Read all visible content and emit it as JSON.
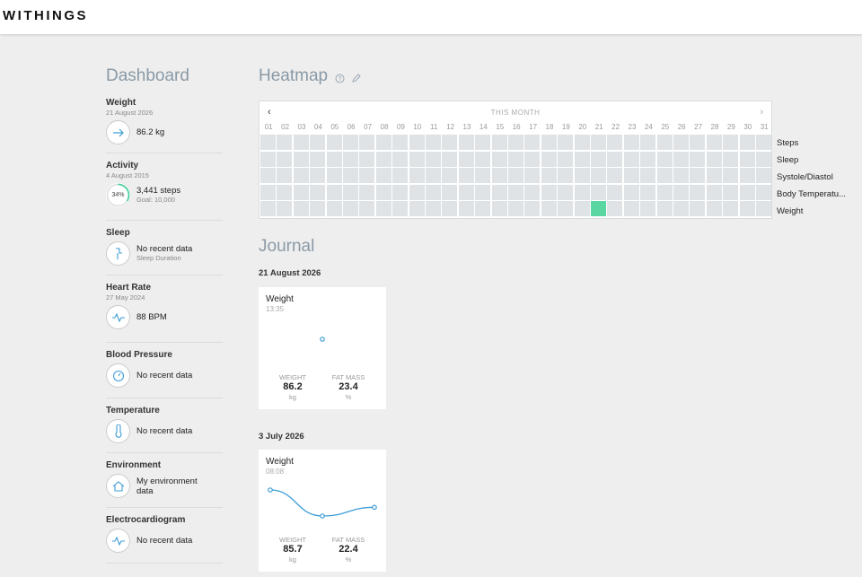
{
  "brand": "WITHINGS",
  "sidebar": {
    "title": "Dashboard",
    "items": [
      {
        "label": "Weight",
        "date": "21 August 2026",
        "value": "86.2 kg",
        "sub": "",
        "icon": "arrow-right-icon"
      },
      {
        "label": "Activity",
        "date": "4 August 2015",
        "value": "3,441 steps",
        "sub": "Goal: 10,000",
        "icon": "activity-ring-icon",
        "ring_text": "34%",
        "progress": 0.34
      },
      {
        "label": "Sleep",
        "date": "",
        "value": "No recent data",
        "sub": "Sleep Duration",
        "icon": "sleep-icon"
      },
      {
        "label": "Heart Rate",
        "date": "27 May 2024",
        "value": "88 BPM",
        "sub": "",
        "icon": "heartbeat-icon"
      },
      {
        "label": "Blood Pressure",
        "date": "",
        "value": "No recent data",
        "sub": "",
        "icon": "gauge-icon"
      },
      {
        "label": "Temperature",
        "date": "",
        "value": "No recent data",
        "sub": "",
        "icon": "thermometer-icon"
      },
      {
        "label": "Environment",
        "date": "",
        "value": "My environment data",
        "sub": "",
        "icon": "home-icon"
      },
      {
        "label": "Electrocardiogram",
        "date": "",
        "value": "No recent data",
        "sub": "",
        "icon": "ecg-icon"
      }
    ]
  },
  "heatmap": {
    "title": "Heatmap",
    "month_label": "THIS MONTH",
    "days": [
      "01",
      "02",
      "03",
      "04",
      "05",
      "06",
      "07",
      "08",
      "09",
      "10",
      "11",
      "12",
      "13",
      "14",
      "15",
      "16",
      "17",
      "18",
      "19",
      "20",
      "21",
      "22",
      "23",
      "24",
      "25",
      "26",
      "27",
      "28",
      "29",
      "30",
      "31"
    ],
    "rows": [
      "Steps",
      "Sleep",
      "Systole/Diastol",
      "Body Temperatu...",
      "Weight"
    ],
    "active_cells": [
      {
        "row": 4,
        "day": 21
      }
    ],
    "active_color": "#5ad6a3"
  },
  "journal": {
    "title": "Journal",
    "entries": [
      {
        "date": "21 August 2026",
        "card_title": "Weight",
        "time": "13:35",
        "points": [
          86.2
        ],
        "stats": [
          {
            "label": "WEIGHT",
            "value": "86.2",
            "unit": "kg"
          },
          {
            "label": "FAT MASS",
            "value": "23.4",
            "unit": "%"
          }
        ]
      },
      {
        "date": "3 July 2026",
        "card_title": "Weight",
        "time": "08:08",
        "points": [
          86.7,
          85.5,
          85.9
        ],
        "stats": [
          {
            "label": "WEIGHT",
            "value": "85.7",
            "unit": "kg"
          },
          {
            "label": "FAT MASS",
            "value": "22.4",
            "unit": "%"
          }
        ]
      }
    ]
  },
  "colors": {
    "accent": "#3d9dd6",
    "heat_cell": "#dfe3e6"
  }
}
